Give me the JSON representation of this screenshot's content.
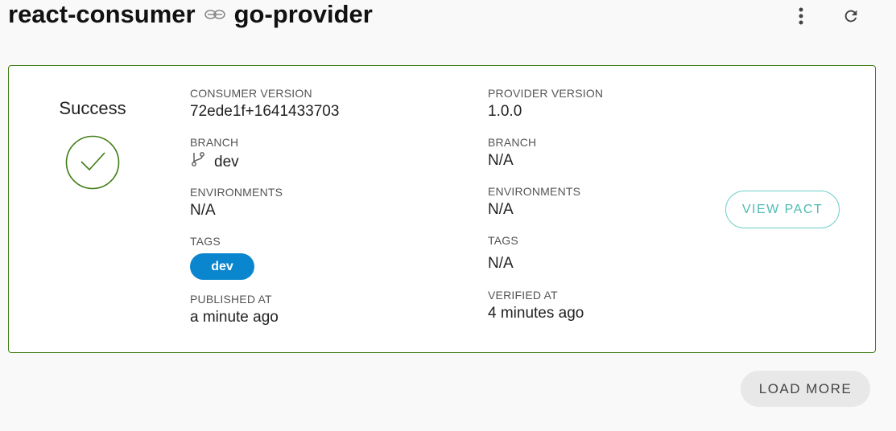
{
  "header": {
    "consumer": "react-consumer",
    "provider": "go-provider",
    "link_icon": "infinity-link-icon",
    "menu_icon": "more-vertical-icon",
    "refresh_icon": "refresh-icon"
  },
  "card": {
    "status": "Success",
    "status_icon": "check-circle-icon",
    "consumer": {
      "version_label": "CONSUMER VERSION",
      "version": "72ede1f+1641433703",
      "branch_label": "BRANCH",
      "branch": "dev",
      "branch_icon": "git-branch-icon",
      "environments_label": "ENVIRONMENTS",
      "environments": "N/A",
      "tags_label": "TAGS",
      "tags": [
        "dev"
      ],
      "published_label": "PUBLISHED AT",
      "published": "a minute ago"
    },
    "provider": {
      "version_label": "PROVIDER VERSION",
      "version": "1.0.0",
      "branch_label": "BRANCH",
      "branch": "N/A",
      "environments_label": "ENVIRONMENTS",
      "environments": "N/A",
      "tags_label": "TAGS",
      "tags": "N/A",
      "verified_label": "VERIFIED AT",
      "verified": "4 minutes ago"
    },
    "view_pact_label": "VIEW PACT"
  },
  "load_more_label": "LOAD MORE",
  "colors": {
    "success": "#3f7d15",
    "tag": "#0a86cf",
    "view_pact": "#4fbab3",
    "background": "#f9f9f9"
  }
}
